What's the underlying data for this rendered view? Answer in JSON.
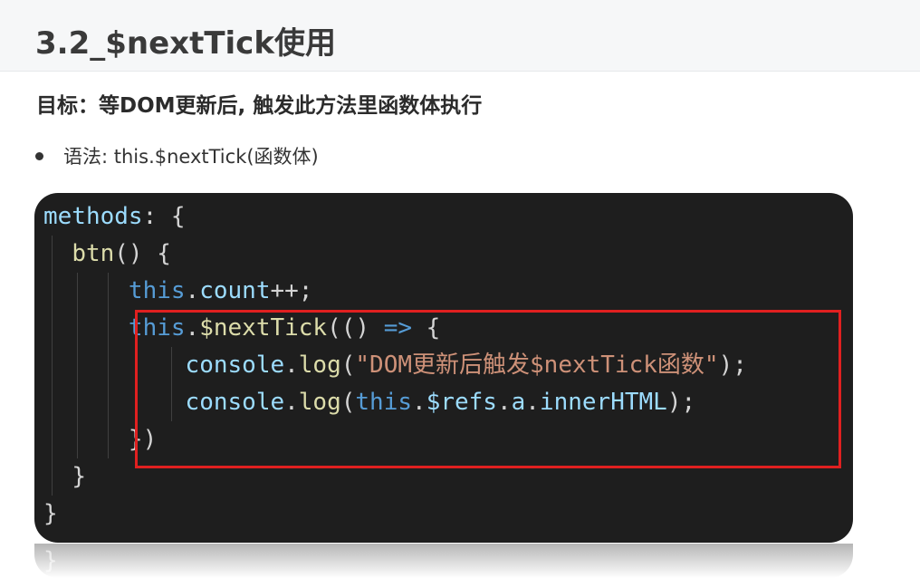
{
  "title": "3.2_$nextTick使用",
  "subheading": "目标：等DOM更新后, 触发此方法里函数体执行",
  "bullet": "语法: this.$nextTick(函数体)",
  "code": {
    "l1": {
      "a": "methods",
      "b": ": {"
    },
    "l2": {
      "a": "btn",
      "b": "() {"
    },
    "l3": {
      "a": "this",
      "b": ".",
      "c": "count",
      "d": "++;"
    },
    "l4": {
      "a": "this",
      "b": ".",
      "c": "$nextTick",
      "d": "((",
      "e": ") ",
      "f": "=>",
      "g": " {"
    },
    "l5": {
      "a": "console",
      "b": ".",
      "c": "log",
      "d": "(",
      "e": "\"DOM更新后触发$nextTick函数\"",
      "f": ");"
    },
    "l6": {
      "a": "console",
      "b": ".",
      "c": "log",
      "d": "(",
      "e": "this",
      "f": ".",
      "g": "$refs",
      "h": ".",
      "i": "a",
      "j": ".",
      "k": "innerHTML",
      "l": ");"
    },
    "l7": {
      "a": "})"
    },
    "l8": {
      "a": "}"
    },
    "l9": {
      "a": "}"
    }
  },
  "reflection_text": "}",
  "colors": {
    "keyword": "#569cd6",
    "function": "#dcdcaa",
    "property": "#9cdcfe",
    "string": "#ce9178",
    "highlight_border": "#e02020",
    "code_bg": "#1e1e1e"
  }
}
